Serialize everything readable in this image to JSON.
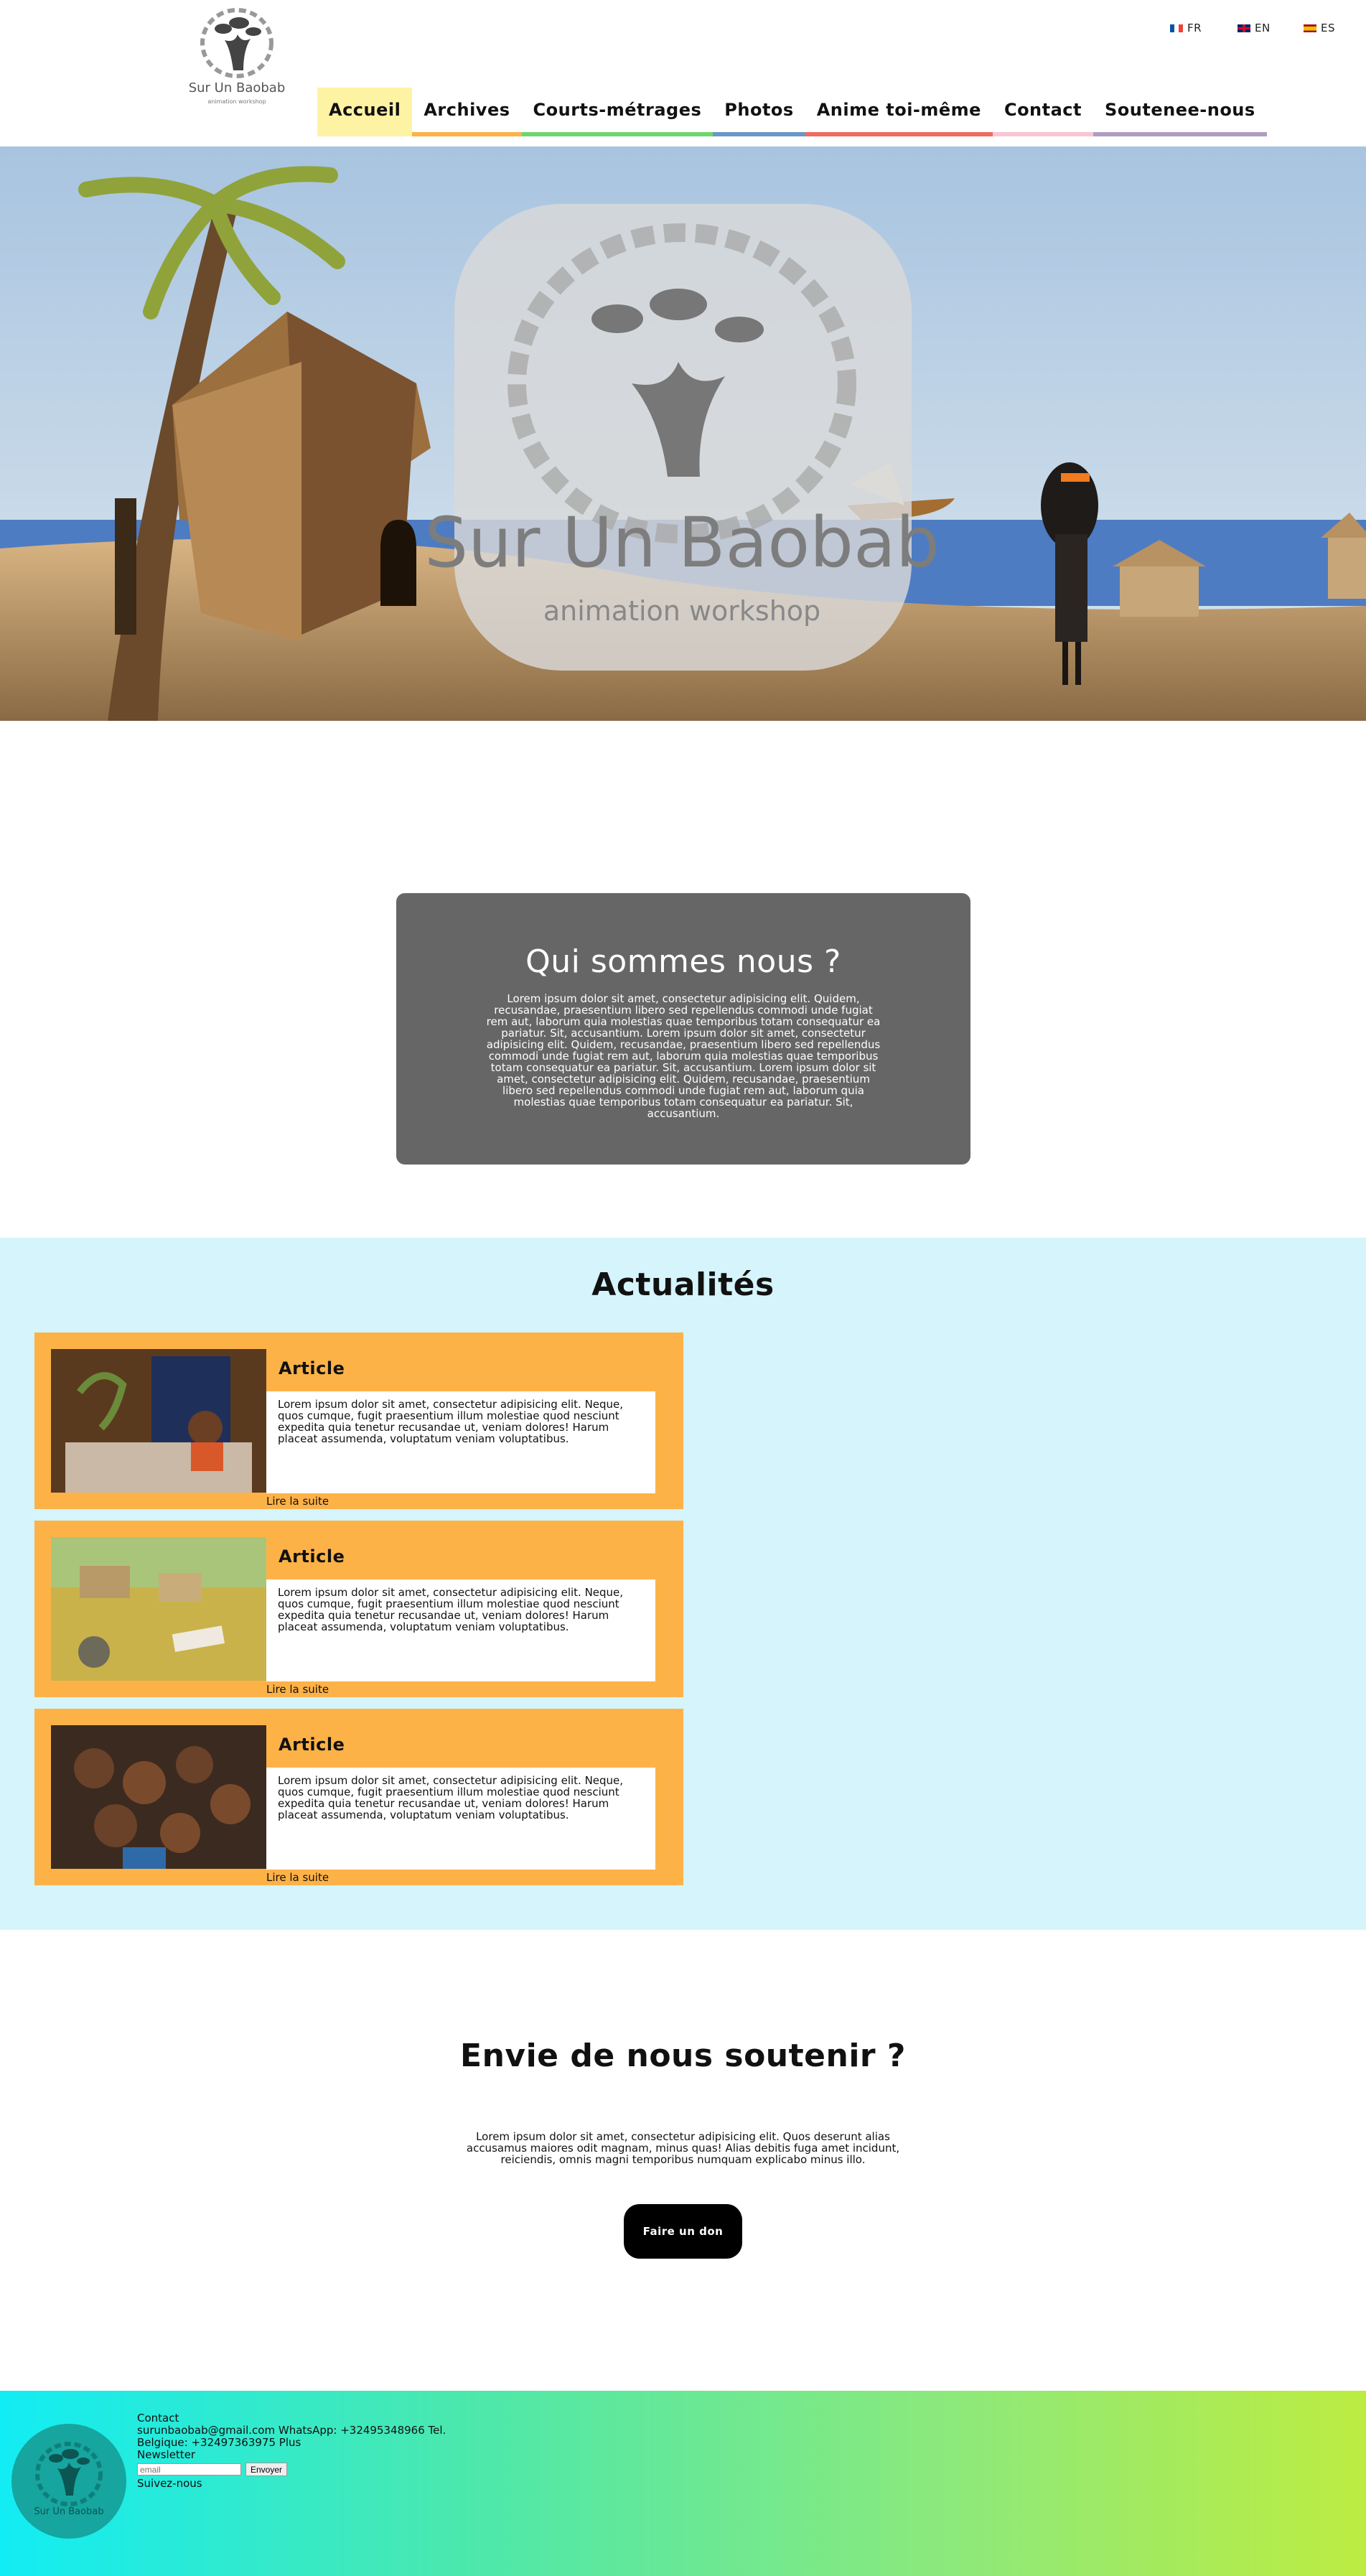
{
  "header": {
    "logo_text": "Sur Un Baobab",
    "logo_sub": "animation workshop",
    "languages": [
      {
        "code": "FR"
      },
      {
        "code": "EN"
      },
      {
        "code": "ES"
      }
    ],
    "nav": [
      {
        "label": "Accueil",
        "color": "#fef3a3"
      },
      {
        "label": "Archives",
        "color": "#fdb247"
      },
      {
        "label": "Courts-métrages",
        "color": "#6fd56f"
      },
      {
        "label": "Photos",
        "color": "#6b97c7"
      },
      {
        "label": "Anime toi-même",
        "color": "#f06b5e"
      },
      {
        "label": "Contact",
        "color": "#f9c6d4"
      },
      {
        "label": "Soutenee-nous",
        "color": "#b09dc2"
      }
    ]
  },
  "hero": {
    "title": "Sur Un Baobab",
    "subtitle": "animation workshop"
  },
  "about": {
    "title": "Qui sommes nous ?",
    "body": "Lorem ipsum dolor sit amet, consectetur adipisicing elit. Quidem, recusandae, praesentium libero sed repellendus commodi unde fugiat rem aut, laborum quia molestias quae temporibus totam consequatur ea pariatur. Sit, accusantium. Lorem ipsum dolor sit amet, consectetur adipisicing elit. Quidem, recusandae, praesentium libero sed repellendus commodi unde fugiat rem aut, laborum quia molestias quae temporibus totam consequatur ea pariatur. Sit, accusantium. Lorem ipsum dolor sit amet, consectetur adipisicing elit. Quidem, recusandae, praesentium libero sed repellendus commodi unde fugiat rem aut, laborum quia molestias quae temporibus totam consequatur ea pariatur. Sit, accusantium."
  },
  "news": {
    "title": "Actualités",
    "articles": [
      {
        "title": "Article",
        "body": "Lorem ipsum dolor sit amet, consectetur adipisicing elit. Neque, quos cumque, fugit praesentium illum molestiae quod nesciunt expedita quia tenetur recusandae ut, veniam dolores! Harum placeat assumenda, voluptatum veniam voluptatibus.",
        "more": "Lire la suite"
      },
      {
        "title": "Article",
        "body": "Lorem ipsum dolor sit amet, consectetur adipisicing elit. Neque, quos cumque, fugit praesentium illum molestiae quod nesciunt expedita quia tenetur recusandae ut, veniam dolores! Harum placeat assumenda, voluptatum veniam voluptatibus.",
        "more": "Lire la suite"
      },
      {
        "title": "Article",
        "body": "Lorem ipsum dolor sit amet, consectetur adipisicing elit. Neque, quos cumque, fugit praesentium illum molestiae quod nesciunt expedita quia tenetur recusandae ut, veniam dolores! Harum placeat assumenda, voluptatum veniam voluptatibus.",
        "more": "Lire la suite"
      }
    ]
  },
  "support": {
    "title": "Envie de nous soutenir ?",
    "body": "Lorem ipsum dolor sit amet, consectetur adipisicing elit. Quos deserunt alias accusamus maiores odit magnam, minus quas! Alias debitis fuga amet incidunt, reiciendis, omnis magni temporibus numquam explicabo minus illo.",
    "button": "Faire un don"
  },
  "footer": {
    "contact_title": "Contact",
    "line1": "surunbaobab@gmail.com WhatsApp: +32495348966 Tel.",
    "line2": "Belgique: +32497363975 Plus",
    "newsletter": "Newsletter",
    "email_placeholder": "email",
    "send": "Envoyer",
    "follow": "Suivez-nous",
    "logo_text": "Sur Un Baobab"
  }
}
